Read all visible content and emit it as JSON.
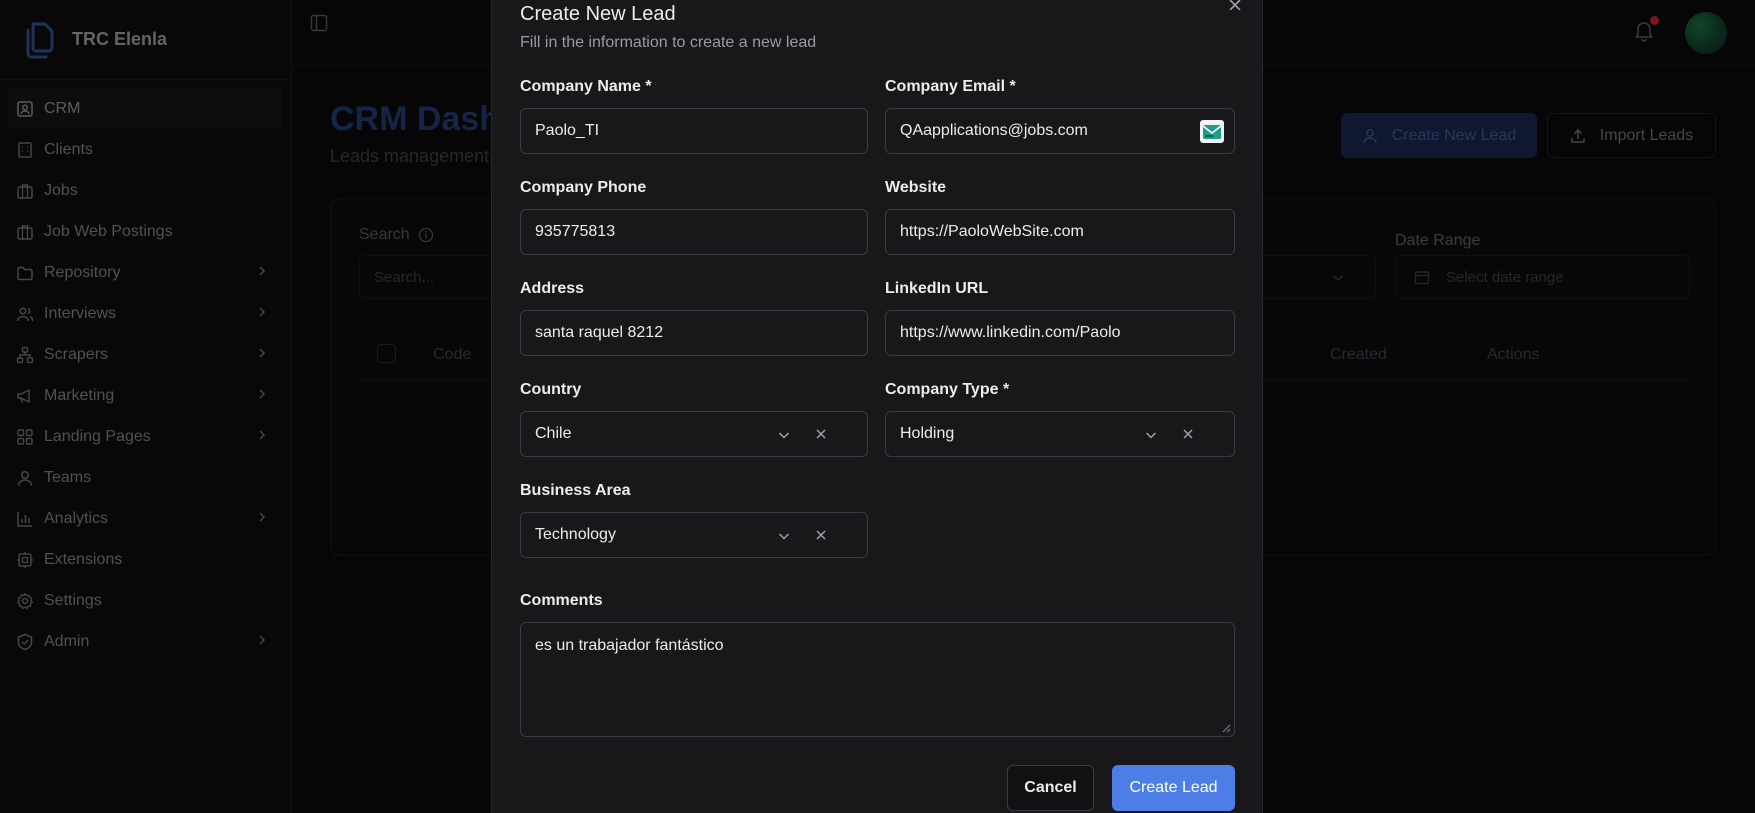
{
  "app": {
    "name": "TRC Elenla"
  },
  "sidebar": {
    "items": [
      {
        "label": "CRM",
        "icon": "contact-icon",
        "active": true,
        "has_children": false
      },
      {
        "label": "Clients",
        "icon": "building-icon",
        "active": false,
        "has_children": false
      },
      {
        "label": "Jobs",
        "icon": "briefcase-icon",
        "active": false,
        "has_children": false
      },
      {
        "label": "Job Web Postings",
        "icon": "briefcase-icon",
        "active": false,
        "has_children": false
      },
      {
        "label": "Repository",
        "icon": "folder-icon",
        "active": false,
        "has_children": true
      },
      {
        "label": "Interviews",
        "icon": "users-icon",
        "active": false,
        "has_children": true
      },
      {
        "label": "Scrapers",
        "icon": "network-icon",
        "active": false,
        "has_children": true
      },
      {
        "label": "Marketing",
        "icon": "megaphone-icon",
        "active": false,
        "has_children": true
      },
      {
        "label": "Landing Pages",
        "icon": "grid-icon",
        "active": false,
        "has_children": true
      },
      {
        "label": "Teams",
        "icon": "user-icon",
        "active": false,
        "has_children": false
      },
      {
        "label": "Analytics",
        "icon": "chart-icon",
        "active": false,
        "has_children": true
      },
      {
        "label": "Extensions",
        "icon": "puzzle-icon",
        "active": false,
        "has_children": false
      },
      {
        "label": "Settings",
        "icon": "gear-icon",
        "active": false,
        "has_children": false
      },
      {
        "label": "Admin",
        "icon": "shield-icon",
        "active": false,
        "has_children": true
      }
    ]
  },
  "background": {
    "page_title": "CRM Dash",
    "page_subtitle": "Leads management",
    "create_lead_label": "Create New Lead",
    "import_leads_label": "Import Leads",
    "search_label": "Search",
    "search_placeholder": "Search...",
    "date_range_label": "Date Range",
    "date_range_placeholder": "Select date range",
    "table_headers": {
      "code": "Code",
      "created": "Created",
      "actions": "Actions"
    }
  },
  "modal": {
    "title": "Create New Lead",
    "subtitle": "Fill in the information to create a new lead",
    "fields": {
      "company_name": {
        "label": "Company Name *",
        "value": "Paolo_TI"
      },
      "company_email": {
        "label": "Company Email *",
        "value": "QAapplications@jobs.com"
      },
      "company_phone": {
        "label": "Company Phone",
        "value": "935775813"
      },
      "website": {
        "label": "Website",
        "value": "https://PaoloWebSite.com"
      },
      "address": {
        "label": "Address",
        "value": "santa raquel 8212"
      },
      "linkedin": {
        "label": "LinkedIn URL",
        "value": "https://www.linkedin.com/Paolo"
      },
      "country": {
        "label": "Country",
        "value": "Chile"
      },
      "company_type": {
        "label": "Company Type *",
        "value": "Holding"
      },
      "business_area": {
        "label": "Business Area",
        "value": "Technology"
      },
      "comments": {
        "label": "Comments",
        "value": "es un trabajador fantástico"
      }
    },
    "cancel_label": "Cancel",
    "submit_label": "Create Lead"
  },
  "colors": {
    "accent": "#4d7ee6",
    "background": "#0a0a0b",
    "modal": "#18181b",
    "notification": "#b52a2a"
  }
}
